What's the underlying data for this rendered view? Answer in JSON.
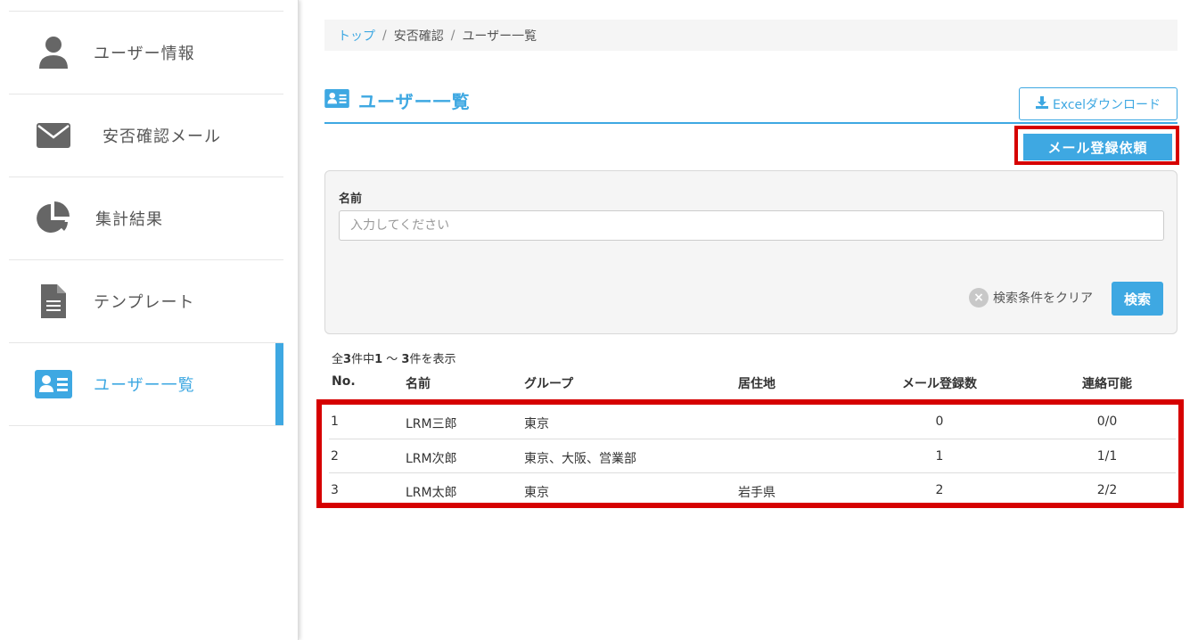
{
  "sidebar": {
    "items": [
      {
        "label": "ユーザー情報",
        "icon": "user-icon"
      },
      {
        "label": "安否確認メール",
        "icon": "envelope-icon"
      },
      {
        "label": "集計結果",
        "icon": "pie-chart-icon"
      },
      {
        "label": "テンプレート",
        "icon": "document-icon"
      },
      {
        "label": "ユーザー一覧",
        "icon": "id-card-icon",
        "active": true
      }
    ]
  },
  "breadcrumb": {
    "top": "トップ",
    "sep": "/",
    "section": "安否確認",
    "current": "ユーザー一覧"
  },
  "page": {
    "title": "ユーザー一覧",
    "excel_button": "Excelダウンロード",
    "mail_request_button": "メール登録依頼"
  },
  "search": {
    "name_label": "名前",
    "name_placeholder": "入力してください",
    "name_value": "",
    "clear_label": "検索条件をクリア",
    "search_button": "検索"
  },
  "results": {
    "prefix": "全",
    "total": "3",
    "mid": "件中",
    "from": "1",
    "tilde": " ～ ",
    "to": "3",
    "suffix": "件を表示"
  },
  "table": {
    "headers": [
      "No.",
      "名前",
      "グループ",
      "居住地",
      "メール登録数",
      "連絡可能"
    ],
    "rows": [
      [
        "1",
        "LRM三郎",
        "東京",
        "",
        "0",
        "0/0"
      ],
      [
        "2",
        "LRM次郎",
        "東京、大阪、営業部",
        "",
        "1",
        "1/1"
      ],
      [
        "3",
        "LRM太郎",
        "東京",
        "岩手県",
        "2",
        "2/2"
      ]
    ]
  },
  "colors": {
    "accent": "#3ea8e2",
    "highlight": "#d60000"
  }
}
